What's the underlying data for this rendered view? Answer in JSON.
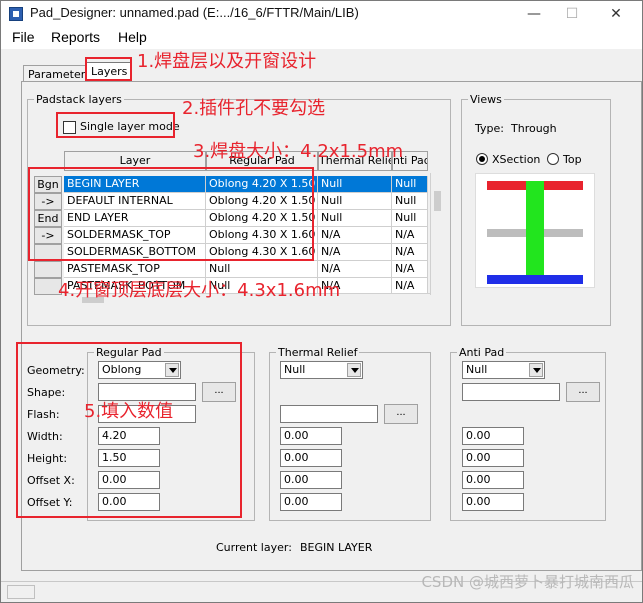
{
  "window": {
    "title": "Pad_Designer: unnamed.pad (E:.../16_6/FTTR/Main/LIB)",
    "minimize": "—",
    "maximize": "☐",
    "close": "✕"
  },
  "menu": [
    "File",
    "Reports",
    "Help"
  ],
  "tabs": {
    "parameters": "Parameters",
    "layers": "Layers"
  },
  "padstack": {
    "group_label": "Padstack layers",
    "single_layer_mode": "Single layer mode",
    "single_layer_checked": false,
    "columns": [
      "Layer",
      "Regular Pad",
      "Thermal Relief",
      "Anti Pad"
    ],
    "columns_visible": [
      "Layer",
      "Regular Pad",
      "Thermal Relief",
      "nti Pad"
    ],
    "row_buttons": [
      "Bgn",
      "->",
      "End",
      "->",
      "",
      "",
      ""
    ],
    "rows": [
      {
        "layer": "BEGIN LAYER",
        "regular": "Oblong 4.20 X 1.50",
        "thermal": "Null",
        "anti": "Null",
        "selected": true
      },
      {
        "layer": "DEFAULT INTERNAL",
        "regular": "Oblong 4.20 X 1.50",
        "thermal": "Null",
        "anti": "Null"
      },
      {
        "layer": "END LAYER",
        "regular": "Oblong 4.20 X 1.50",
        "thermal": "Null",
        "anti": "Null"
      },
      {
        "layer": "SOLDERMASK_TOP",
        "regular": "Oblong 4.30 X 1.60",
        "thermal": "N/A",
        "anti": "N/A"
      },
      {
        "layer": "SOLDERMASK_BOTTOM",
        "regular": "Oblong 4.30 X 1.60",
        "thermal": "N/A",
        "anti": "N/A"
      },
      {
        "layer": "PASTEMASK_TOP",
        "regular": "Null",
        "thermal": "N/A",
        "anti": "N/A"
      },
      {
        "layer": "PASTEMASK_BOTTOM",
        "regular": "Null",
        "thermal": "N/A",
        "anti": "N/A"
      }
    ]
  },
  "views": {
    "group_label": "Views",
    "type_label": "Type:",
    "type_value": "Through",
    "xsection": "XSection",
    "top": "Top",
    "colors": {
      "pad": "#e8242e",
      "drill": "#22e51e",
      "internal": "#bdbdbd",
      "bottom": "#1f2ee8"
    }
  },
  "regular_pad": {
    "group_label": "Regular Pad",
    "geometry_label": "Geometry:",
    "geometry": "Oblong",
    "shape_label": "Shape:",
    "shape": "",
    "flash_label": "Flash:",
    "flash": "",
    "width_label": "Width:",
    "width": "4.20",
    "height_label": "Height:",
    "height": "1.50",
    "offsetx_label": "Offset X:",
    "offsetx": "0.00",
    "offsety_label": "Offset Y:",
    "offsety": "0.00",
    "browse": "..."
  },
  "thermal": {
    "group_label": "Thermal Relief",
    "geometry": "Null",
    "flash": "",
    "width": "0.00",
    "height": "0.00",
    "offsetx": "0.00",
    "offsety": "0.00",
    "browse": "..."
  },
  "anti": {
    "group_label": "Anti Pad",
    "geometry": "Null",
    "shape": "",
    "width": "0.00",
    "height": "0.00",
    "offsetx": "0.00",
    "offsety": "0.00",
    "browse": "..."
  },
  "current_layer": {
    "label": "Current layer:",
    "value": "BEGIN LAYER"
  },
  "annotations": {
    "a1": "1.焊盘层以及开窗设计",
    "a2": "2.插件孔不要勾选",
    "a3": "3.焊盘大小：4.2x1.5mm",
    "a4": "4.开窗顶层底层大小：4.3x1.6mm",
    "a5": "5.填入数值",
    "color": "#e8242e"
  },
  "watermark": "CSDN @城西萝卜暴打城南西瓜"
}
